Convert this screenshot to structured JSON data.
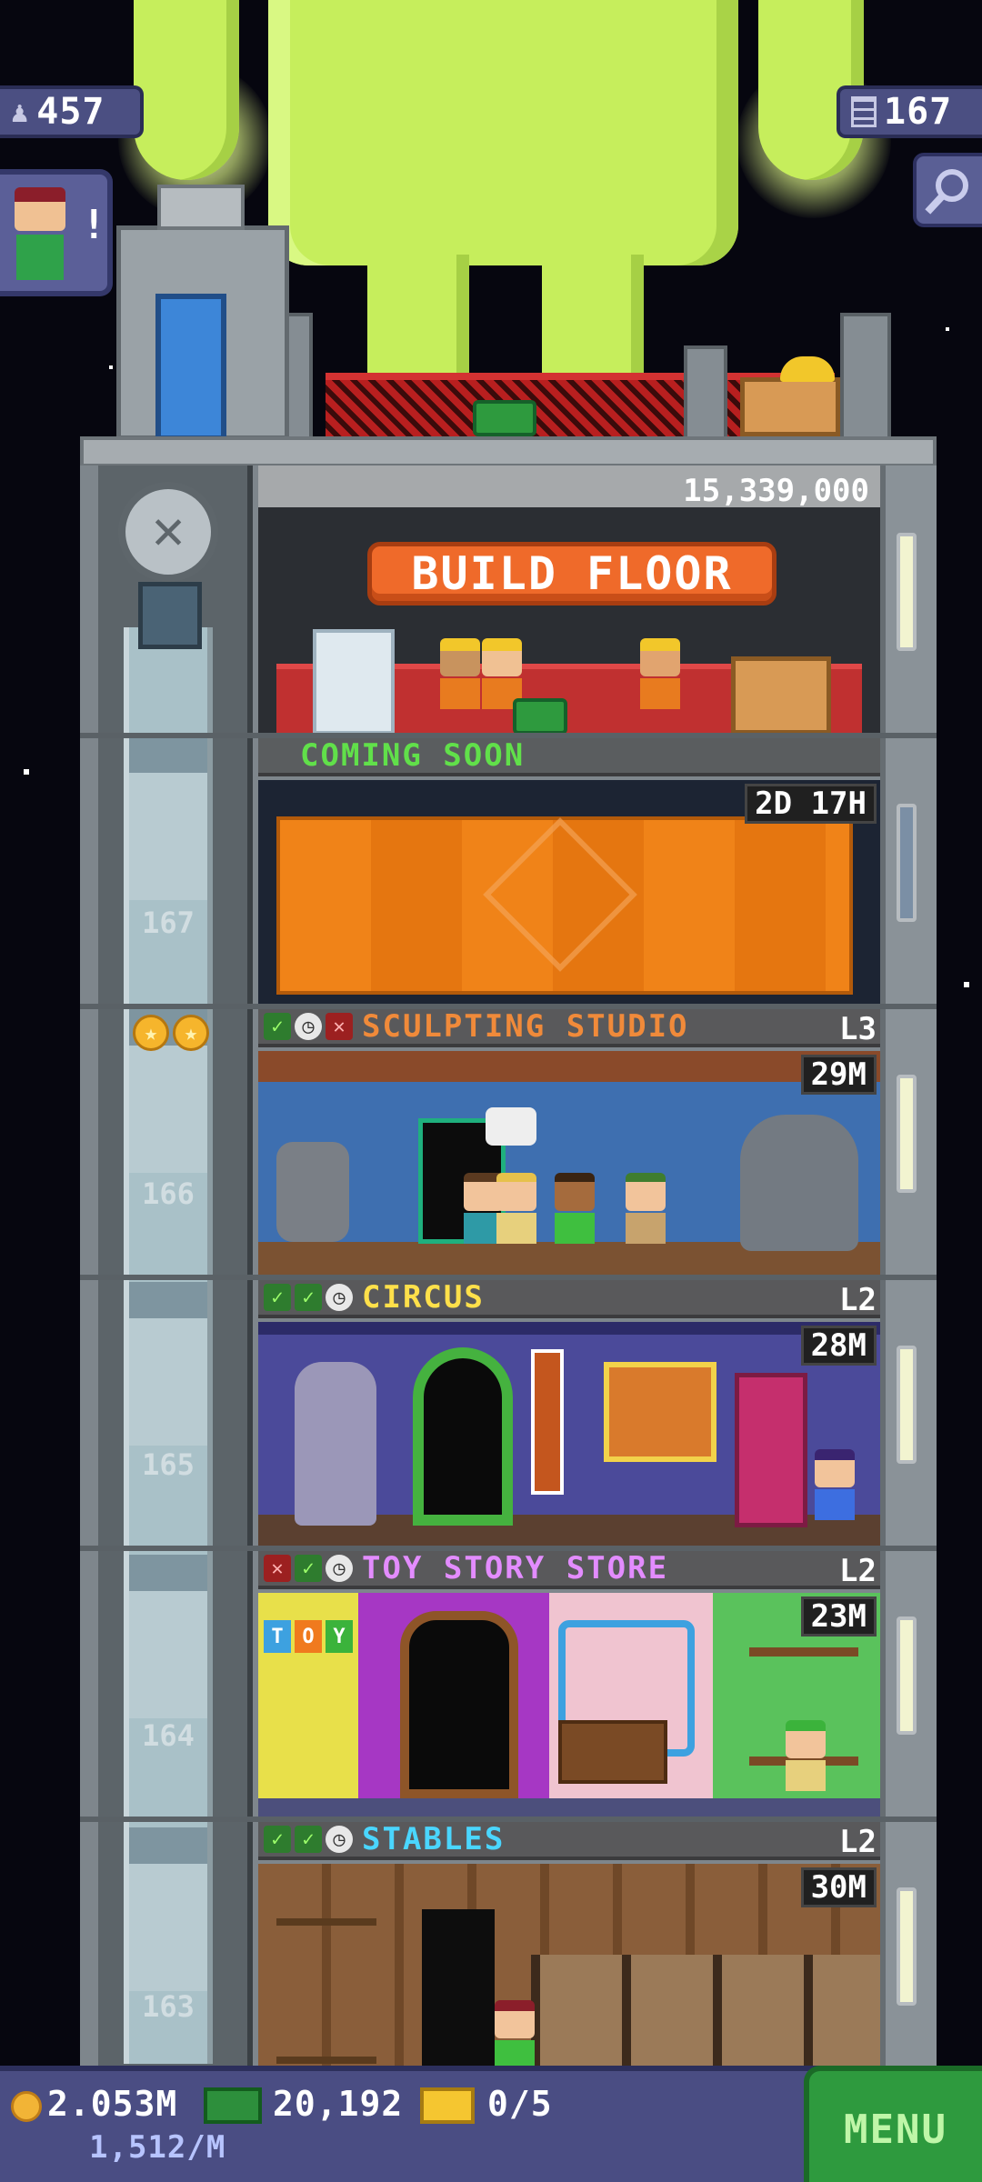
{
  "top_stats": {
    "residents": "457",
    "floors": "167"
  },
  "build_floor": {
    "price": "15,339,000",
    "button_label": "BUILD FLOOR"
  },
  "coming_soon": {
    "label": "COMING SOON",
    "timer": "2D 17H",
    "floor_number": "167"
  },
  "floors": [
    {
      "number": "166",
      "name": "SCULPTING STUDIO",
      "level": "L3",
      "price": "29M",
      "status": [
        "ok",
        "clock",
        "no"
      ],
      "name_color": "#f08a3a",
      "stars": 2
    },
    {
      "number": "165",
      "name": "CIRCUS",
      "level": "L2",
      "price": "28M",
      "status": [
        "ok",
        "ok",
        "clock"
      ],
      "name_color": "#ffe04a",
      "stars": 0
    },
    {
      "number": "164",
      "name": "TOY STORY STORE",
      "level": "L2",
      "price": "23M",
      "status": [
        "no",
        "ok",
        "clock"
      ],
      "name_color": "#e38cff",
      "stars": 0
    },
    {
      "number": "163",
      "name": "STABLES",
      "level": "L2",
      "price": "30M",
      "status": [
        "ok",
        "ok",
        "clock"
      ],
      "name_color": "#4ad6ff",
      "stars": 0
    }
  ],
  "bottom_bar": {
    "coins": "2.053M",
    "coins_rate": "1,512/M",
    "bux": "20,192",
    "tickets": "0/5",
    "menu_label": "MENU"
  },
  "icons": [
    "person-icon",
    "floors-icon",
    "magnifier-icon",
    "coin-icon",
    "bux-icon",
    "ticket-icon",
    "check-icon",
    "clock-icon",
    "x-icon",
    "star-icon"
  ],
  "colors": {
    "android_green": "#c6ee5c",
    "tarp_orange": "#f2851c",
    "build_button": "#ef6a2a",
    "coming_soon_text": "#61e04a",
    "menu_green": "#2e9a3e"
  }
}
